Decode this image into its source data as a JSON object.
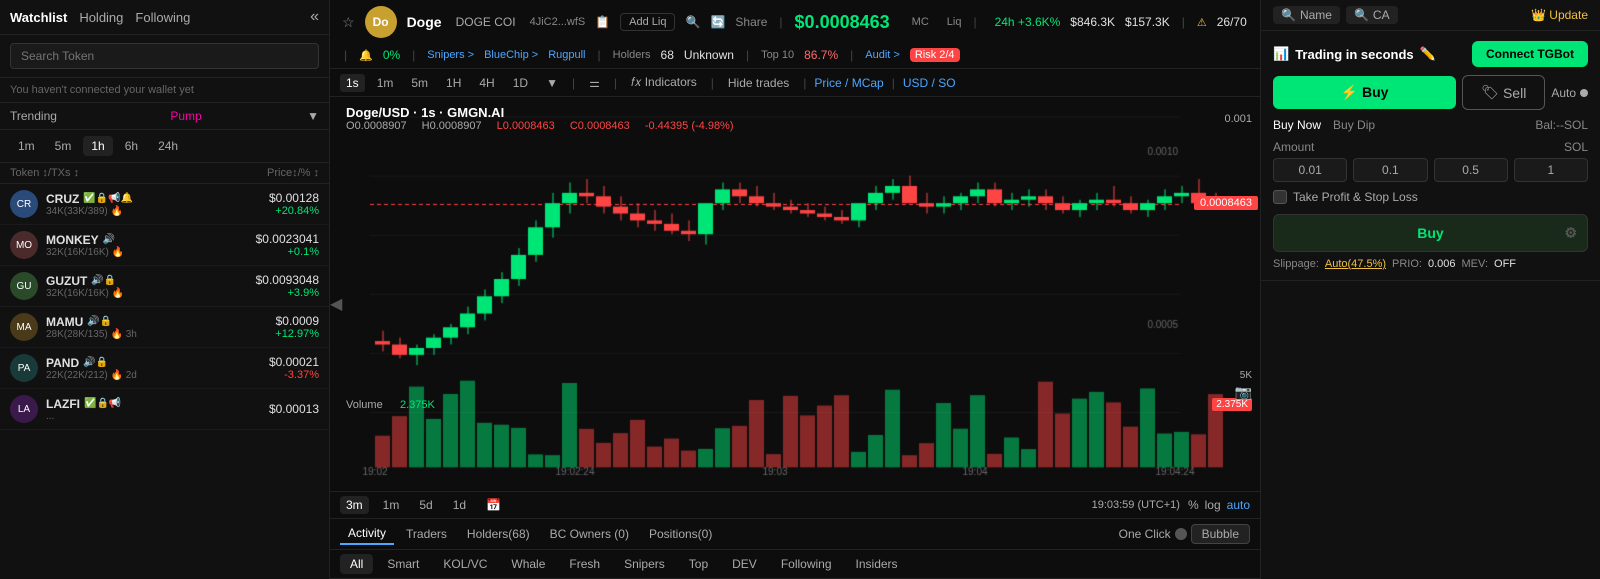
{
  "sidebar": {
    "tabs": [
      "Watchlist",
      "Holding",
      "Following"
    ],
    "active_tab": "Watchlist",
    "collapse_icon": "«",
    "search_placeholder": "Search Token",
    "wallet_notice": "You haven't connected your wallet yet",
    "trending": {
      "label": "Trending",
      "pump": "Pump",
      "filter_icon": "▼"
    },
    "time_tabs": [
      "1m",
      "5m",
      "1h",
      "6h",
      "24h"
    ],
    "active_time": "1h",
    "list_header": {
      "token": "Token",
      "txs": "TXs",
      "price": "Price↕/%"
    },
    "tokens": [
      {
        "symbol": "CRUZ",
        "avatar_text": "CR",
        "avatar_bg": "#2a4a7a",
        "stats": "34K(33K/389) 🔥",
        "price": "$0.00128",
        "change": "+20.84%",
        "positive": true,
        "icons": "✅🔒📢🔔"
      },
      {
        "symbol": "MONKEY",
        "avatar_text": "MO",
        "avatar_bg": "#4a2a2a",
        "stats": "32K(16K/16K) 🔥",
        "price": "$0.0023041",
        "change": "+0.1%",
        "positive": true,
        "icons": "🔊"
      },
      {
        "symbol": "GUZUT",
        "avatar_text": "GU",
        "avatar_bg": "#2a4a2a",
        "stats": "32K(16K/16K) 🔥",
        "price": "$0.0093048",
        "change": "+3.9%",
        "positive": true,
        "icons": "🔊🔒"
      },
      {
        "symbol": "MAMU",
        "avatar_text": "MA",
        "avatar_bg": "#4a3a1a",
        "stats": "28K(28K/135) 🔥 3h",
        "price": "$0.0009",
        "change": "+12.97%",
        "positive": true,
        "icons": "🔊🔒"
      },
      {
        "symbol": "PAND",
        "avatar_text": "PA",
        "avatar_bg": "#1a3a3a",
        "stats": "22K(22K/212) 🔥 2d",
        "price": "$0.00021",
        "change": "-3.37%",
        "positive": false,
        "icons": "🔊🔒"
      },
      {
        "symbol": "LAZFI",
        "avatar_text": "LA",
        "avatar_bg": "#3a1a4a",
        "stats": "...",
        "price": "$0.00013",
        "change": "",
        "positive": true,
        "icons": "✅🔒📢"
      }
    ]
  },
  "topbar": {
    "token_name": "Doge",
    "token_sym": "DOGE COI",
    "token_addr": "4JiC2...wfS",
    "avatar_text": "Do",
    "avatar_bg": "#c8a030",
    "add_liq": "Add Liq",
    "share": "Share",
    "price": "$0.0008463",
    "mc_label": "MC",
    "liq_label": "Liq",
    "change_24h": "24h +3.6K%",
    "mc_val": "$846.3K",
    "liq_val": "$157.3K",
    "snipers_label": "Snipers >",
    "sniper_count": "26/70",
    "bluechip_label": "BlueChip >",
    "rugpull_label": "Rugpull",
    "holders_label": "Holders",
    "holders_count": "68",
    "pct": "0%",
    "alert_icon": "🔔",
    "unknown_label": "Unknown",
    "top10_label": "Top 10",
    "top10_val": "86.7%",
    "audit_label": "Audit >",
    "risk_label": "Risk 2/4"
  },
  "chart_toolbar": {
    "time_buttons": [
      "1s",
      "1m",
      "5m",
      "1H",
      "4H",
      "1D"
    ],
    "active_time": "1s",
    "chart_type_icon": "⚌",
    "indicators_label": "Indicators",
    "hide_trades_label": "Hide trades",
    "price_mcap": "Price / MCap",
    "usd_sol": "USD / SO"
  },
  "ohlc": {
    "pair": "Doge/USD · 1s · GMGN.AI",
    "o_label": "O",
    "o_val": "0.0008907",
    "h_label": "H",
    "h_val": "0.0008907",
    "l_label": "L",
    "l_val": "0.0008463",
    "c_label": "C",
    "c_val": "0.0008463",
    "change": "-0.44395 (-4.98%)",
    "price_top": "0.001",
    "price_mid": "0.0005",
    "current_price": "0.0008463",
    "vol_label": "Volume",
    "vol_val": "2.375K",
    "vol_5k": "5K",
    "vol_badge": "2.375K"
  },
  "chart_bottom": {
    "time_buttons": [
      "3m",
      "1m",
      "5d",
      "1d"
    ],
    "calendar_icon": "📅",
    "time_display": "19:03:59 (UTC+1)",
    "pct_label": "%",
    "log_label": "log",
    "auto_label": "auto",
    "times": [
      "19:02",
      "19:02:24",
      "19:03",
      "19:04",
      "19:04:24"
    ]
  },
  "bottom_tabs": {
    "tabs": [
      "Activity",
      "Traders",
      "Holders(68)",
      "BC Owners (0)",
      "Positions(0)"
    ],
    "active_tab": "Activity",
    "one_click_label": "One Click",
    "bubble_label": "Bubble"
  },
  "filter_tabs": {
    "tabs": [
      "All",
      "Smart",
      "KOL/VC",
      "Whale",
      "Fresh",
      "Snipers",
      "Top",
      "DEV",
      "Following",
      "Insiders"
    ],
    "active_tab": "All"
  },
  "right_panel": {
    "name_btn": "Name",
    "ca_btn": "CA",
    "update_label": "Update",
    "trading": {
      "title": "Trading in seconds",
      "pen_icon": "✏️",
      "connect_btn": "Connect TGBot",
      "buy_label": "⚡ Buy",
      "sell_label": "Sell",
      "auto_label": "Auto",
      "buy_now_label": "Buy Now",
      "buy_dip_label": "Buy Dip",
      "bal_label": "Bal:--SOL",
      "amount_label": "Amount",
      "sol_label": "SOL",
      "presets": [
        "0.01",
        "0.1",
        "0.5",
        "1"
      ],
      "take_profit_label": "Take Profit & Stop Loss",
      "buy_execute_label": "Buy",
      "slippage_label": "Slippage:",
      "slippage_val": "Auto(47.5%)",
      "prio_label": "PRIO:",
      "prio_val": "0.006",
      "mev_label": "MEV:",
      "mev_val": "OFF"
    }
  }
}
